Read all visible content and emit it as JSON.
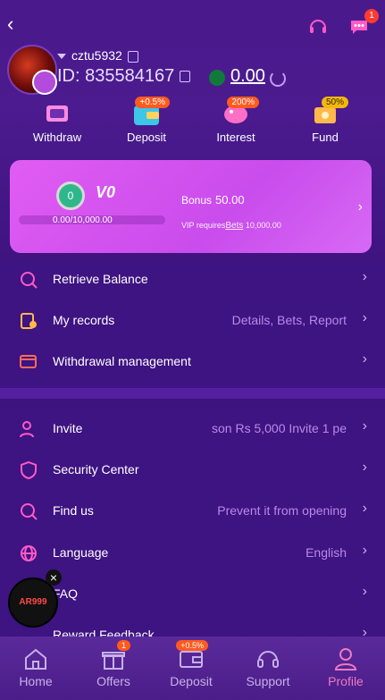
{
  "profile": {
    "username": "cztu5932",
    "id_label": "ID:",
    "id_value": "835584167",
    "balance": "0.00"
  },
  "quick_actions": [
    {
      "label": "Withdraw",
      "icon": "withdraw-icon"
    },
    {
      "label": "Deposit",
      "icon": "wallet-icon",
      "badge": "+0.5%"
    },
    {
      "label": "Interest",
      "icon": "piggy-bank-icon",
      "badge": "200%"
    },
    {
      "label": "Fund",
      "icon": "fund-icon",
      "badge": "50%"
    }
  ],
  "vip": {
    "medal": "0",
    "level": "V0",
    "progress_text": "0.00/10,000.00",
    "progress_fraction": 0,
    "bonus_label": "Bonus",
    "bonus_value": "50.00",
    "requires_label": "VIP requires",
    "bets_label": "Bets",
    "requires_value": "10,000.00"
  },
  "menu_group1": [
    {
      "label": "Retrieve Balance",
      "value": "",
      "icon": "retrieve-balance-icon"
    },
    {
      "label": "My records",
      "value": "Details, Bets, Report",
      "icon": "records-icon"
    },
    {
      "label": "Withdrawal management",
      "value": "",
      "icon": "withdrawal-management-icon"
    }
  ],
  "menu_group2": [
    {
      "label": "Invite",
      "value": "son Rs 5,000  Invite 1 pe",
      "icon": "invite-icon"
    },
    {
      "label": "Security Center",
      "value": "",
      "icon": "shield-icon"
    },
    {
      "label": "Find us",
      "value": "Prevent it from opening",
      "icon": "find-us-icon"
    },
    {
      "label": "Language",
      "value": "English",
      "icon": "globe-icon"
    },
    {
      "label": "FAQ",
      "value": "",
      "icon": "faq-icon"
    },
    {
      "label": "Reward Feedback",
      "value": "",
      "icon": "feedback-icon"
    }
  ],
  "floating": {
    "logo_text": "AR999",
    "close": "×"
  },
  "chat_badge": "1",
  "bottom_nav": [
    {
      "label": "Home",
      "icon": "home-icon"
    },
    {
      "label": "Offers",
      "icon": "gift-icon",
      "badge": "1"
    },
    {
      "label": "Deposit",
      "icon": "wallet-icon",
      "badge": "+0.5%"
    },
    {
      "label": "Support",
      "icon": "headset-icon"
    },
    {
      "label": "Profile",
      "icon": "profile-icon",
      "active": true
    }
  ],
  "colors": {
    "background": "#3e1382",
    "card": "#d65cf1",
    "accent_pink": "#ef79c1",
    "badge_red": "#ff5a1f"
  }
}
